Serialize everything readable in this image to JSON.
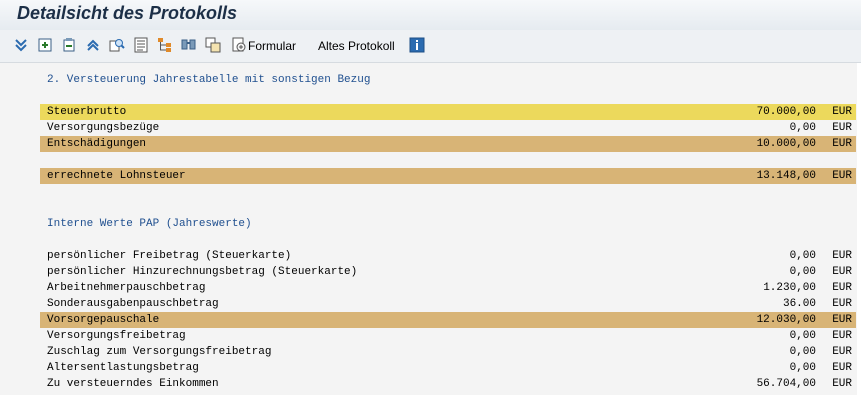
{
  "window": {
    "title": "Detailsicht des Protokolls"
  },
  "toolbar": {
    "formular_label": "Formular",
    "altes_protokoll_label": "Altes Protokoll"
  },
  "sections": {
    "s1_title": "2. Versteuerung Jahrestabelle mit sonstigen Bezug",
    "s2_title": "Interne Werte PAP (Jahreswerte)"
  },
  "rows": [
    {
      "label": "Steuerbrutto",
      "value": "70.000,00",
      "currency": "EUR",
      "highlight": "yellow"
    },
    {
      "label": "Versorgungsbezüge",
      "value": "0,00",
      "currency": "EUR",
      "highlight": "none"
    },
    {
      "label": "Entschädigungen",
      "value": "10.000,00",
      "currency": "EUR",
      "highlight": "orange"
    },
    {
      "label": "errechnete Lohnsteuer",
      "value": "13.148,00",
      "currency": "EUR",
      "highlight": "orange"
    },
    {
      "label": "persönlicher Freibetrag (Steuerkarte)",
      "value": "0,00",
      "currency": "EUR",
      "highlight": "none"
    },
    {
      "label": "persönlicher Hinzurechnungsbetrag (Steuerkarte)",
      "value": "0,00",
      "currency": "EUR",
      "highlight": "none"
    },
    {
      "label": "Arbeitnehmerpauschbetrag",
      "value": "1.230,00",
      "currency": "EUR",
      "highlight": "none"
    },
    {
      "label": "Sonderausgabenpauschbetrag",
      "value": "36.00",
      "currency": "EUR",
      "highlight": "none"
    },
    {
      "label": "Vorsorgepauschale",
      "value": "12.030,00",
      "currency": "EUR",
      "highlight": "orange"
    },
    {
      "label": "Versorgungsfreibetrag",
      "value": "0,00",
      "currency": "EUR",
      "highlight": "none"
    },
    {
      "label": "Zuschlag zum Versorgungsfreibetrag",
      "value": "0,00",
      "currency": "EUR",
      "highlight": "none"
    },
    {
      "label": "Altersentlastungsbetrag",
      "value": "0,00",
      "currency": "EUR",
      "highlight": "none"
    },
    {
      "label": "Zu versteuerndes Einkommen",
      "value": "56.704,00",
      "currency": "EUR",
      "highlight": "none"
    }
  ],
  "colors": {
    "highlight_yellow": "#ecd95c",
    "highlight_orange": "#d8b476",
    "section_text": "#1f4f8f"
  },
  "icons": [
    "collapse-all-icon",
    "expand-subtree-icon",
    "expand-node-icon",
    "collapse-node-icon",
    "find-icon",
    "details-icon",
    "hierarchy-icon",
    "find-next-icon",
    "copy-icon",
    "form-icon",
    "info-icon"
  ]
}
